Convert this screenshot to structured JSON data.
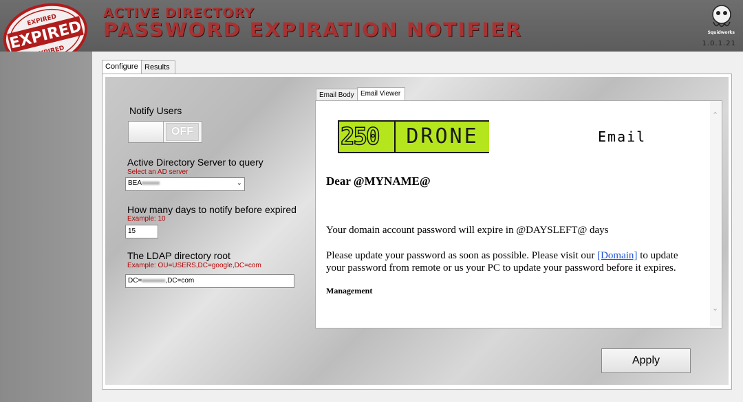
{
  "header": {
    "title_line1": "ACTIVE DIRECTORY",
    "title_line2": "PASSWORD EXPIRATION NOTIFIER",
    "stamp_top": "EXPIRED",
    "stamp_main": "EXPIRED",
    "stamp_bottom": "EXPIRED",
    "logo_text": "Squidworks",
    "version": "1.0.1.21"
  },
  "tabs": [
    {
      "label": "Configure",
      "active": true
    },
    {
      "label": "Results",
      "active": false
    }
  ],
  "config": {
    "notify_users_label": "Notify Users",
    "toggle_state": "OFF",
    "ad_server_label": "Active Directory Server to query",
    "ad_server_hint": "Select an AD server",
    "ad_server_value": "BEA",
    "days_label": "How many days to notify before expired",
    "days_hint": "Example: 10",
    "days_value": "15",
    "ldap_label": "The LDAP directory root",
    "ldap_hint": "Example: OU=USERS,DC=google,DC=com",
    "ldap_value_prefix": "DC=",
    "ldap_value_suffix": ",DC=com"
  },
  "email_tabs": [
    {
      "label": "Email Body",
      "active": false
    },
    {
      "label": "Email Viewer",
      "active": true
    }
  ],
  "email": {
    "logo_num": "250",
    "logo_word": "DRONE",
    "heading": "Email",
    "greeting": "Dear @MYNAME@",
    "line1": "Your domain account password will expire in @DAYSLEFT@ days",
    "line2_a": "Please update your password as soon as possible. Please visit our ",
    "line2_link": "[Domain]",
    "line2_b": " to update your password from remote or us your PC to update your password before it expires.",
    "signature": "Management"
  },
  "buttons": {
    "apply": "Apply"
  },
  "colors": {
    "title_red": "#a83232",
    "hint_red": "#b00000",
    "drone_green": "#b5e61d"
  }
}
